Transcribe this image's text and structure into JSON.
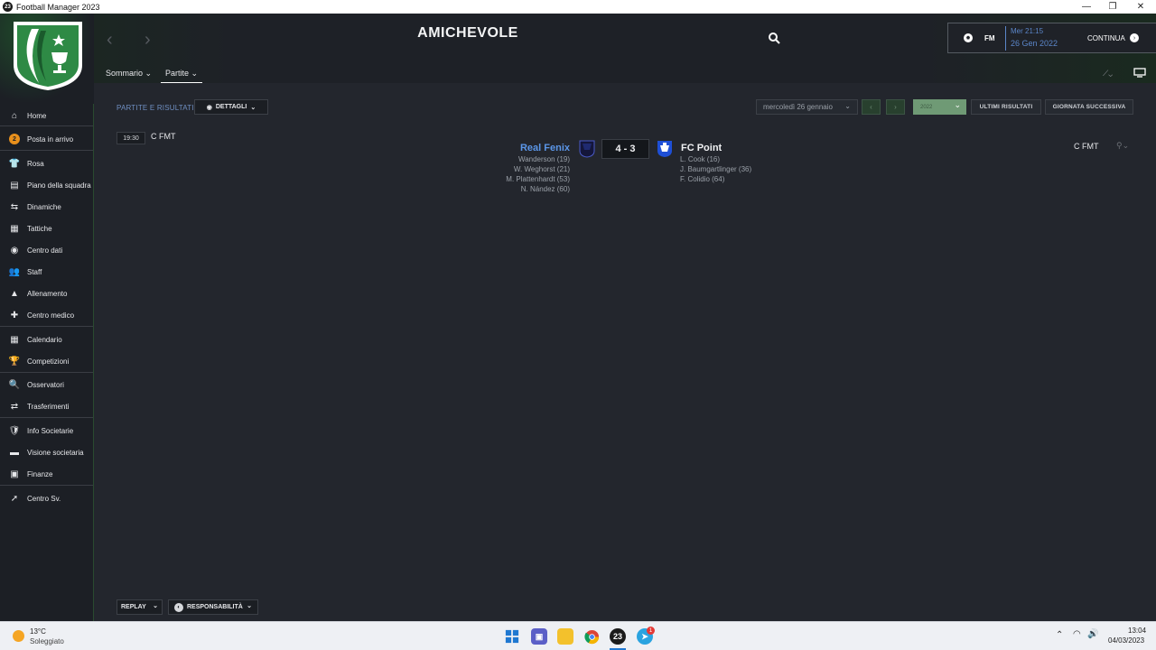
{
  "window": {
    "title": "Football Manager 2023",
    "app_icon_text": "23",
    "minimize": "—",
    "maximize": "❐",
    "close": "✕"
  },
  "header": {
    "page_title": "AMICHEVOLE",
    "date_day": "Mer 21:15",
    "date_full": "26 Gen 2022",
    "fm_label": "FM",
    "continue_label": "CONTINUA",
    "tabs": [
      {
        "label": "Sommario ⌄"
      },
      {
        "label": "Partite ⌄"
      }
    ]
  },
  "sidebar": {
    "items": [
      {
        "label": "Home",
        "icon": "⌂"
      },
      {
        "label": "Posta in arrivo",
        "icon": "✉",
        "badge": "2"
      },
      {
        "label": "Rosa",
        "icon": "👕"
      },
      {
        "label": "Piano della squadra",
        "icon": "▤"
      },
      {
        "label": "Dinamiche",
        "icon": "⇆"
      },
      {
        "label": "Tattiche",
        "icon": "▦"
      },
      {
        "label": "Centro dati",
        "icon": "◉"
      },
      {
        "label": "Staff",
        "icon": "👥"
      },
      {
        "label": "Allenamento",
        "icon": "▲"
      },
      {
        "label": "Centro medico",
        "icon": "✚"
      },
      {
        "label": "Calendario",
        "icon": "▦"
      },
      {
        "label": "Competizioni",
        "icon": "🏆"
      },
      {
        "label": "Osservatori",
        "icon": "🔍"
      },
      {
        "label": "Trasferimenti",
        "icon": "⇄"
      },
      {
        "label": "Info Societarie",
        "icon": "🛡"
      },
      {
        "label": "Visione societaria",
        "icon": "▬"
      },
      {
        "label": "Finanze",
        "icon": "▣"
      },
      {
        "label": "Centro Sv.",
        "icon": "➚"
      }
    ]
  },
  "filters": {
    "section_label": "PARTITE E RISULTATI",
    "details_label": "DETTAGLI",
    "date_value": "mercoledì 26 gennaio",
    "prev": "‹",
    "next": "›",
    "year_value": "2022",
    "latest_results": "ULTIMI RISULTATI",
    "next_day": "GIORNATA SUCCESSIVA"
  },
  "match": {
    "time": "19:30",
    "competition_left": "C FMT",
    "competition_right": "C FMT",
    "home_team": "Real Fenix",
    "away_team": "FC Point",
    "score": "4 - 3",
    "home_scorers": [
      "Wanderson (19)",
      "W. Weghorst (21)",
      "M. Plattenhardt (53)",
      "N. Nández (60)"
    ],
    "away_scorers": [
      "L. Cook (16)",
      "J. Baumgartlinger (36)",
      "F. Colidio (64)"
    ]
  },
  "footer": {
    "replay_label": "REPLAY",
    "responsibility_label": "RESPONSABILITÀ"
  },
  "taskbar": {
    "weather_temp": "13°C",
    "weather_desc": "Soleggiato",
    "time": "13:04",
    "date": "04/03/2023",
    "telegram_badge": "1"
  },
  "colors": {
    "accent_green": "#2e6b3a",
    "link_blue": "#5b96e8",
    "date_blue": "#5b86c9"
  }
}
